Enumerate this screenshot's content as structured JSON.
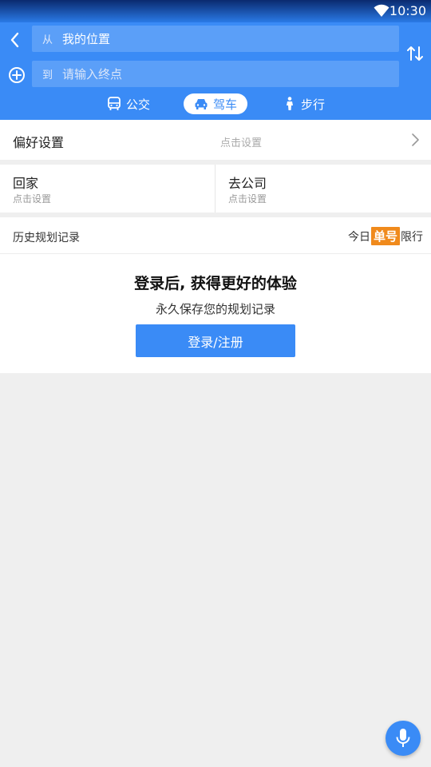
{
  "status_bar": {
    "time": "10:30"
  },
  "route": {
    "from_prefix": "从",
    "from_value": "我的位置",
    "to_prefix": "到",
    "to_placeholder": "请输入终点"
  },
  "modes": [
    {
      "label": "公交",
      "icon": "bus-icon",
      "active": false
    },
    {
      "label": "驾车",
      "icon": "car-icon",
      "active": true
    },
    {
      "label": "步行",
      "icon": "walk-icon",
      "active": false
    }
  ],
  "preferences": {
    "title": "偏好设置",
    "hint": "点击设置"
  },
  "shortcuts": [
    {
      "title": "回家",
      "hint": "点击设置"
    },
    {
      "title": "去公司",
      "hint": "点击设置"
    }
  ],
  "history": {
    "title": "历史规划记录",
    "restriction_prefix": "今日",
    "restriction_badge": "单号",
    "restriction_suffix": "限行"
  },
  "login": {
    "title": "登录后, 获得更好的体验",
    "subtitle": "永久保存您的规划记录",
    "button": "登录/注册"
  },
  "colors": {
    "accent": "#3a8bf6",
    "badge": "#f08a1c"
  }
}
